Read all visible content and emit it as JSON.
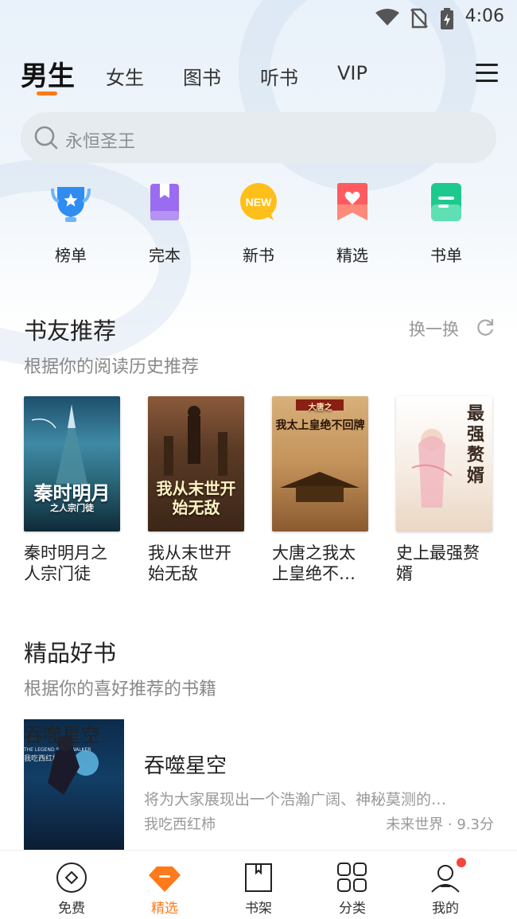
{
  "status_bar": {
    "time": "4:06"
  },
  "top_tabs": [
    {
      "label": "男生",
      "active": true
    },
    {
      "label": "女生",
      "active": false
    },
    {
      "label": "图书",
      "active": false
    },
    {
      "label": "听书",
      "active": false
    },
    {
      "label": "VIP",
      "active": false
    }
  ],
  "search": {
    "placeholder": "永恒圣王"
  },
  "quick_entries": [
    {
      "label": "榜单",
      "icon": "trophy-icon",
      "color": "#2f8cf0"
    },
    {
      "label": "完本",
      "icon": "book-purple-icon",
      "color": "#9a6cf0"
    },
    {
      "label": "新书",
      "icon": "new-badge-icon",
      "color": "#ffb400",
      "badge": "NEW"
    },
    {
      "label": "精选",
      "icon": "heart-bookmark-icon",
      "color": "#ff5a5f"
    },
    {
      "label": "书单",
      "icon": "list-card-icon",
      "color": "#1ec98e"
    }
  ],
  "friends_section": {
    "title": "书友推荐",
    "subtitle": "根据你的阅读历史推荐",
    "refresh_label": "换一换",
    "books": [
      {
        "name": "秦时明月之人宗门徒",
        "cover_text": "秦时明月",
        "cover_sub": "之人宗门徒",
        "color": "#2a6e8a"
      },
      {
        "name": "我从末世开始无敌",
        "cover_text": "我从末世开始无敌",
        "color": "#6a4a2e"
      },
      {
        "name": "大唐之我太上皇绝不…",
        "cover_text": "我太上皇绝不回牌",
        "cover_sub": "大唐之",
        "color": "#c99a5a"
      },
      {
        "name": "史上最强赘婿",
        "cover_text": "最强赘婿",
        "color": "#f2e3d6"
      }
    ]
  },
  "quality_section": {
    "title": "精品好书",
    "subtitle": "根据你的喜好推荐的书籍",
    "featured": {
      "title": "吞噬星空",
      "description": "将为大家展现出一个浩瀚广阔、神秘莫测的…",
      "author": "我吃西红柿",
      "meta": "未来世界 · 9.3分",
      "cover_title": "吞噬星空",
      "cover_sub": "THE LEGEND SPACEWALKER",
      "cover_author": "我吃西红柿 著"
    }
  },
  "bottom_nav": [
    {
      "label": "免费",
      "icon": "free-diamond-icon",
      "active": false
    },
    {
      "label": "精选",
      "icon": "featured-gem-icon",
      "active": true
    },
    {
      "label": "书架",
      "icon": "bookshelf-icon",
      "active": false
    },
    {
      "label": "分类",
      "icon": "category-grid-icon",
      "active": false
    },
    {
      "label": "我的",
      "icon": "profile-icon",
      "active": false,
      "has_dot": true
    }
  ],
  "colors": {
    "accent": "#ff7a1a",
    "dot": "#f5453b"
  }
}
